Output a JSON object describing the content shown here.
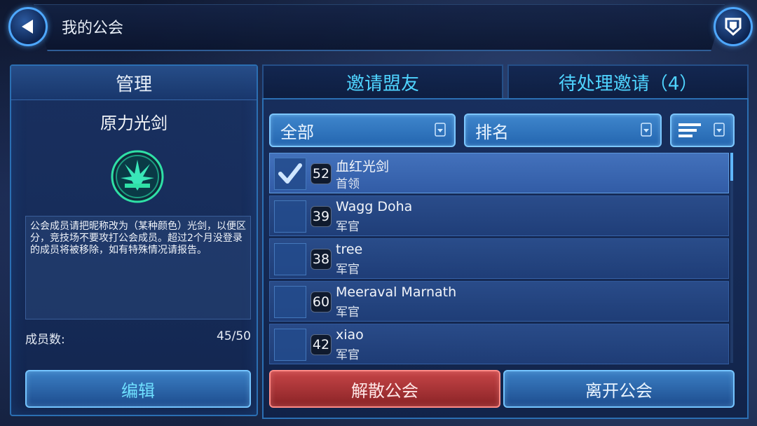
{
  "header": {
    "title": "我的公会"
  },
  "left": {
    "tab_label": "管理",
    "guild_name": "原力光剑",
    "description": "公会成员请把昵称改为（某种颜色）光剑，以便区分，竞技场不要攻打公会成员。超过2个月没登录的成员将被移除，如有特殊情况请报告。",
    "member_count_label": "成员数:",
    "member_count_value": "45/50",
    "edit_button": "编辑"
  },
  "tabs": {
    "invite_label": "邀请盟友",
    "pending_label": "待处理邀请（4）"
  },
  "filters": {
    "filter_value": "全部",
    "rank_value": "排名"
  },
  "members": [
    {
      "level": "52",
      "name": "血红光剑",
      "role": "首领",
      "checked": true
    },
    {
      "level": "39",
      "name": "Wagg Doha",
      "role": "军官",
      "checked": false
    },
    {
      "level": "38",
      "name": "tree",
      "role": "军官",
      "checked": false
    },
    {
      "level": "60",
      "name": "Meeraval Marnath",
      "role": "军官",
      "checked": false
    },
    {
      "level": "42",
      "name": "xiao",
      "role": "军官",
      "checked": false
    }
  ],
  "actions": {
    "disband_label": "解散公会",
    "leave_label": "离开公会"
  },
  "icons": {
    "back": "back-arrow-icon",
    "shield": "shield-icon",
    "emblem": "guild-emblem-icon",
    "sort": "sort-lines-icon",
    "check": "check-icon"
  },
  "colors": {
    "accent": "#4fd4ff",
    "danger": "#c64547",
    "panel_border": "#2b6fb3"
  }
}
